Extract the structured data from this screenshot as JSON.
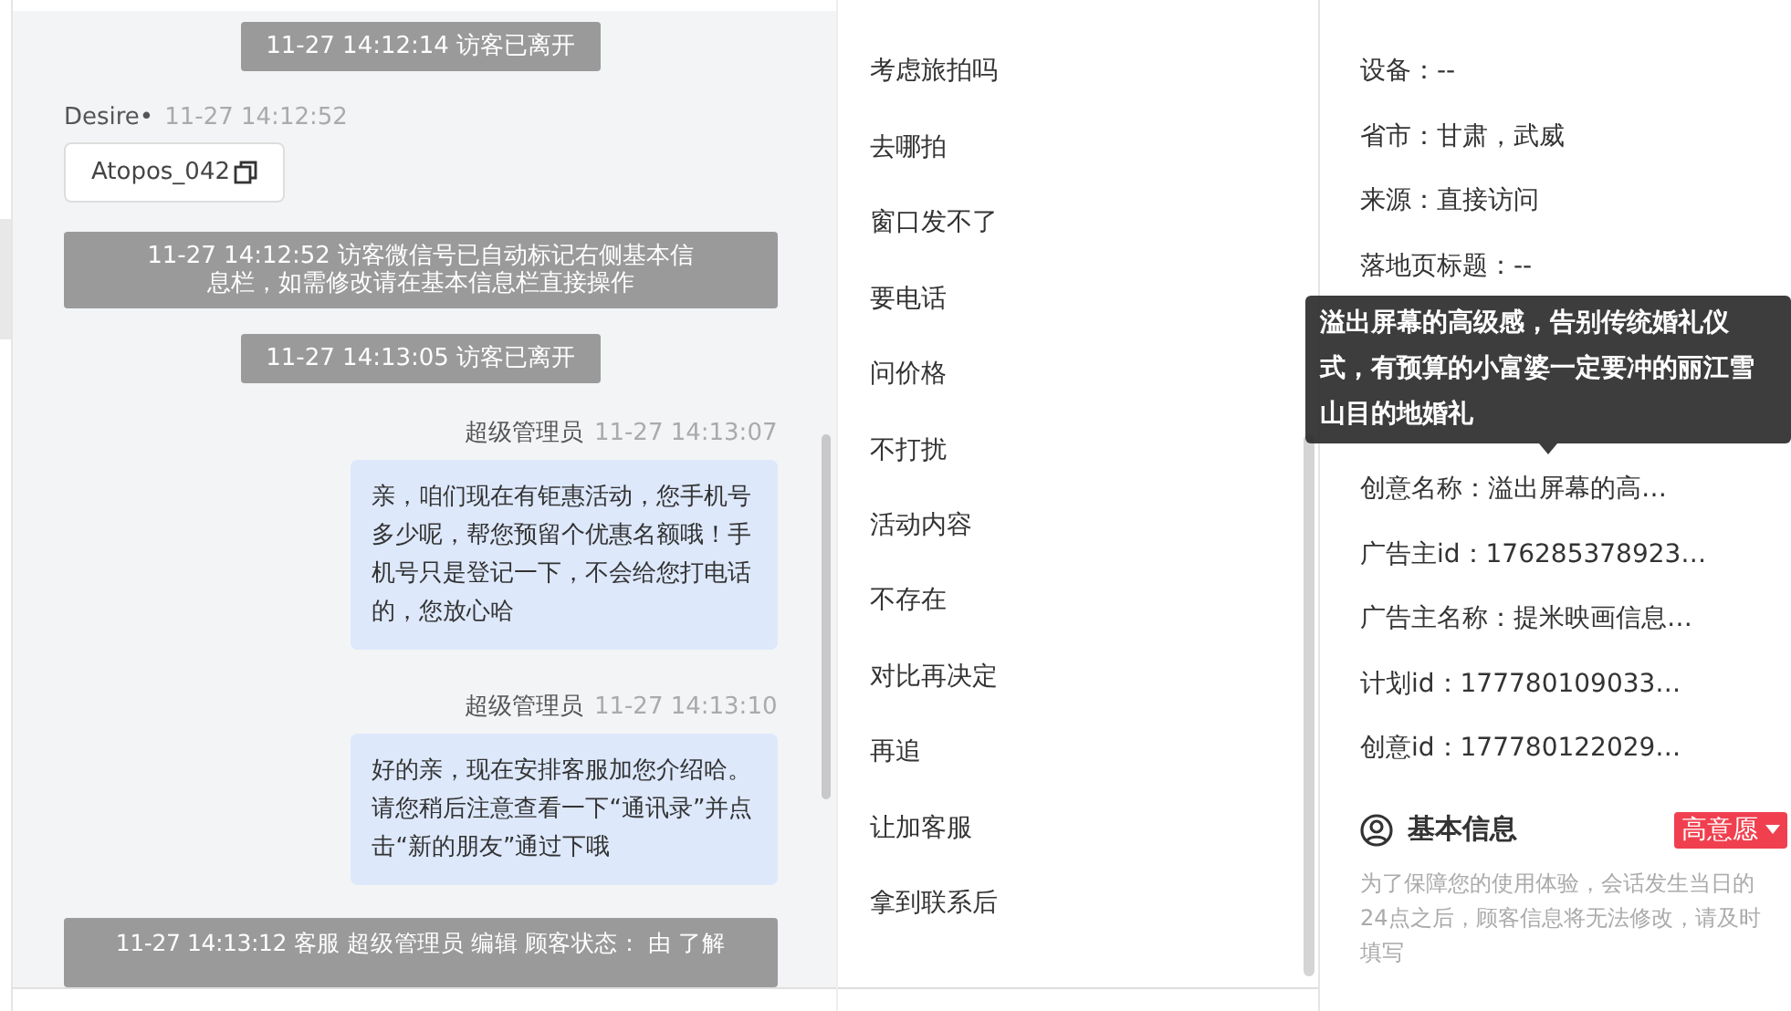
{
  "chat": {
    "messages": [
      {
        "kind": "system",
        "text": "11-27 14:12:14 访客已离开"
      },
      {
        "kind": "visitor",
        "sender": "Desire•",
        "time": "11-27 14:12:52",
        "card": "Atopos_042"
      },
      {
        "kind": "system",
        "text": "11-27 14:12:52 访客微信号已自动标记右侧基本信息栏，如需修改请在基本信息栏直接操作"
      },
      {
        "kind": "system",
        "text": "11-27 14:13:05 访客已离开"
      },
      {
        "kind": "agent",
        "sender": "超级管理员",
        "time": "11-27 14:13:07",
        "text": "亲，咱们现在有钜惠活动，您手机号多少呢，帮您预留个优惠名额哦！手机号只是登记一下，不会给您打电话的，您放心哈"
      },
      {
        "kind": "agent",
        "sender": "超级管理员",
        "time": "11-27 14:13:10",
        "text": "好的亲，现在安排客服加您介绍哈。请您稍后注意查看一下“通讯录”并点击“新的朋友”通过下哦"
      },
      {
        "kind": "system",
        "text": "11-27 14:13:12 客服 超级管理员 编辑 顾客状态： 由 了解"
      }
    ]
  },
  "quick_replies": [
    "考虑旅拍吗",
    "去哪拍",
    "窗口发不了",
    "要电话",
    "问价格",
    "不打扰",
    "活动内容",
    "不存在",
    "对比再决定",
    "再追",
    "让加客服",
    "拿到联系后"
  ],
  "source_info": {
    "fields": [
      "设备：--",
      "省市：甘肃，武威",
      "来源：直接访问",
      "落地页标题：--",
      "创意名称：溢出屏幕的高…",
      "广告主id：176285378923…",
      "广告主名称：提米映画信息…",
      "计划id：177780109033…",
      "创意id：177780122029…"
    ],
    "tooltip": "溢出屏幕的高级感，告别传统婚礼仪式，有预算的小富婆一定要冲的丽江雪山目的地婚礼"
  },
  "basic_info": {
    "title": "基本信息",
    "intent_tag": "高意愿",
    "notice": "为了保障您的使用体验，会话发生当日的24点之后，顾客信息将无法修改，请及时填写"
  }
}
